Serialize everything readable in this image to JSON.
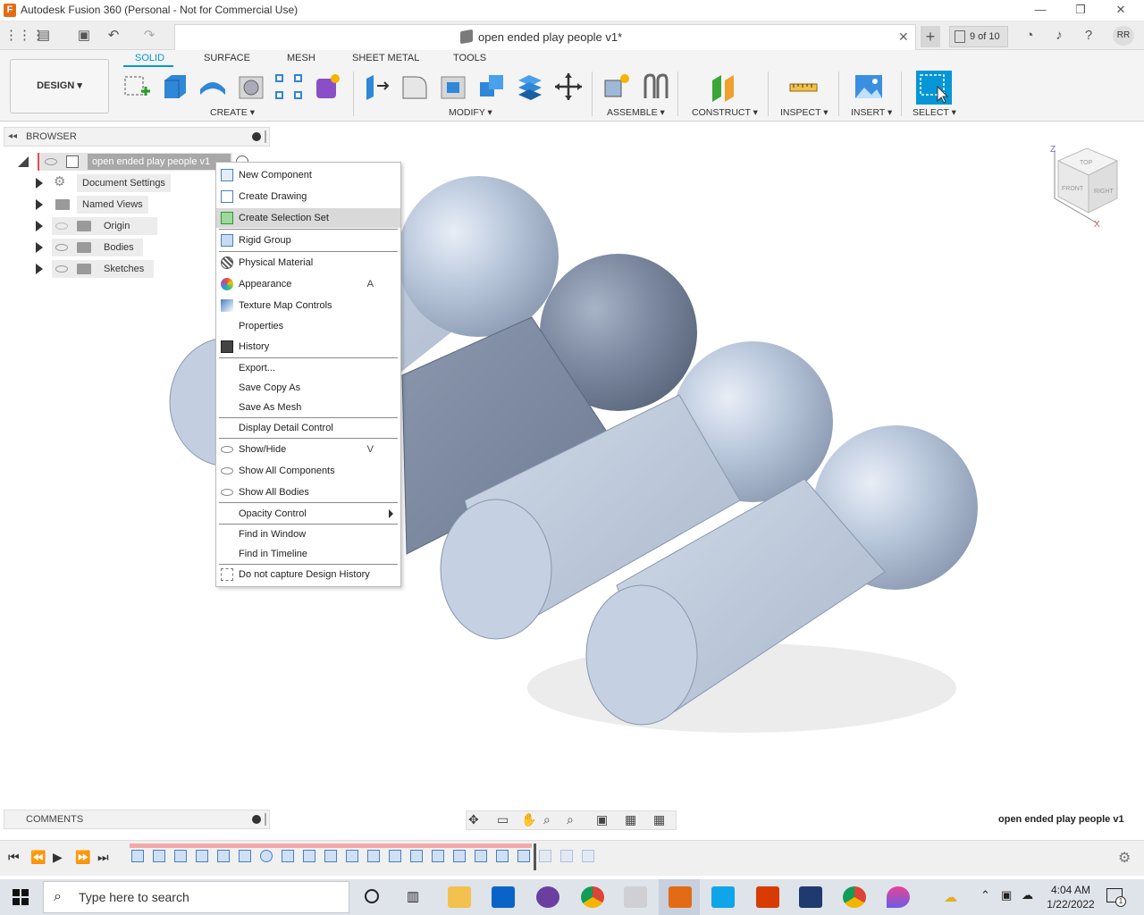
{
  "window": {
    "title": "Autodesk Fusion 360 (Personal - Not for Commercial Use)",
    "logo": "F",
    "minimize": "—",
    "restore": "❐",
    "close": "✕"
  },
  "tabbar": {
    "doc_title": "open ended play people v1*",
    "close": "✕",
    "plus": "+",
    "version": "9 of 10",
    "user_initials": "RR"
  },
  "toolbar": {
    "workspace": "DESIGN ▾",
    "tabs": [
      "SOLID",
      "SURFACE",
      "MESH",
      "SHEET METAL",
      "TOOLS"
    ],
    "groups": [
      "CREATE ▾",
      "MODIFY ▾",
      "ASSEMBLE ▾",
      "CONSTRUCT ▾",
      "INSPECT ▾",
      "INSERT ▾",
      "SELECT ▾"
    ]
  },
  "browser": {
    "title": "BROWSER",
    "root": "open ended play people v1",
    "items": [
      "Document Settings",
      "Named Views",
      "Origin",
      "Bodies",
      "Sketches"
    ]
  },
  "context_menu": {
    "items": [
      {
        "label": "New Component",
        "shortcut": "",
        "icon": "new-component-icon"
      },
      {
        "label": "Create Drawing",
        "shortcut": "",
        "icon": "create-drawing-icon"
      },
      {
        "label": "Create Selection Set",
        "shortcut": "",
        "icon": "selection-set-icon"
      },
      {
        "label": "Rigid Group",
        "shortcut": "",
        "icon": "rigid-group-icon"
      },
      {
        "label": "Physical Material",
        "shortcut": "",
        "icon": "physical-material-icon"
      },
      {
        "label": "Appearance",
        "shortcut": "A",
        "icon": "appearance-icon"
      },
      {
        "label": "Texture Map Controls",
        "shortcut": "",
        "icon": "texture-map-icon"
      },
      {
        "label": "Properties",
        "shortcut": "",
        "icon": ""
      },
      {
        "label": "History",
        "shortcut": "",
        "icon": "history-icon"
      },
      {
        "label": "Export...",
        "shortcut": "",
        "icon": ""
      },
      {
        "label": "Save Copy As",
        "shortcut": "",
        "icon": ""
      },
      {
        "label": "Save As Mesh",
        "shortcut": "",
        "icon": ""
      },
      {
        "label": "Display Detail Control",
        "shortcut": "",
        "icon": ""
      },
      {
        "label": "Show/Hide",
        "shortcut": "V",
        "icon": "eye-icon"
      },
      {
        "label": "Show All Components",
        "shortcut": "",
        "icon": "eye-icon"
      },
      {
        "label": "Show All Bodies",
        "shortcut": "",
        "icon": "eye-icon"
      },
      {
        "label": "Opacity Control",
        "shortcut": "",
        "icon": "submenu-arrow-icon"
      },
      {
        "label": "Find in Window",
        "shortcut": "",
        "icon": ""
      },
      {
        "label": "Find in Timeline",
        "shortcut": "",
        "icon": ""
      },
      {
        "label": "Do not capture Design History",
        "shortcut": "",
        "icon": "history-off-icon"
      }
    ],
    "highlighted": "Create Selection Set"
  },
  "viewcube": {
    "top": "TOP",
    "front": "FRONT",
    "right": "RIGHT",
    "z": "Z",
    "x": "X"
  },
  "comments": {
    "title": "COMMENTS"
  },
  "status": {
    "doc_name": "open ended play people v1"
  },
  "taskbar": {
    "search_placeholder": "Type here to search",
    "time": "4:04 AM",
    "date": "1/22/2022",
    "notif": "1"
  },
  "colors": {
    "accent": "#0696d7",
    "body": "#b8c6da",
    "body_dark": "#7d8aa3",
    "menu_highlight": "#d9d9d9"
  }
}
